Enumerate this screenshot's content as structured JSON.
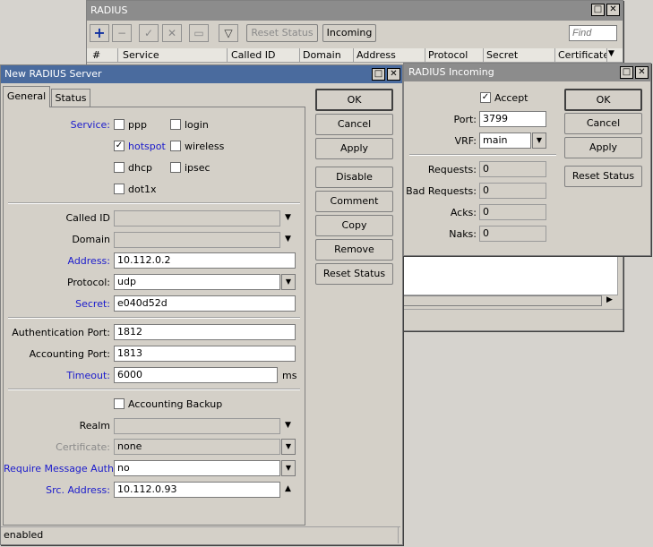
{
  "radius_window": {
    "title": "RADIUS",
    "toolbar": {
      "reset_status": "Reset Status",
      "incoming": "Incoming",
      "find_placeholder": "Find"
    },
    "columns": [
      "#",
      "Service",
      "Called ID",
      "Domain",
      "Address",
      "Protocol",
      "Secret",
      "Certificate"
    ]
  },
  "new_server": {
    "title": "New RADIUS Server",
    "tabs": [
      "General",
      "Status"
    ],
    "service_label": "Service:",
    "services": [
      {
        "name": "ppp",
        "checked": false
      },
      {
        "name": "login",
        "checked": false
      },
      {
        "name": "hotspot",
        "checked": true
      },
      {
        "name": "wireless",
        "checked": false
      },
      {
        "name": "dhcp",
        "checked": false
      },
      {
        "name": "ipsec",
        "checked": false
      },
      {
        "name": "dot1x",
        "checked": false
      }
    ],
    "called_id_label": "Called ID",
    "domain_label": "Domain",
    "address_label": "Address:",
    "address": "10.112.0.2",
    "protocol_label": "Protocol:",
    "protocol": "udp",
    "secret_label": "Secret:",
    "secret": "e040d52d",
    "auth_port_label": "Authentication Port:",
    "auth_port": "1812",
    "acct_port_label": "Accounting Port:",
    "acct_port": "1813",
    "timeout_label": "Timeout:",
    "timeout": "6000",
    "timeout_unit": "ms",
    "accounting_backup_label": "Accounting Backup",
    "realm_label": "Realm",
    "certificate_label": "Certificate:",
    "certificate": "none",
    "require_msg_auth_label": "Require Message Auth:",
    "require_msg_auth": "no",
    "src_address_label": "Src. Address:",
    "src_address": "10.112.0.93",
    "buttons": {
      "ok": "OK",
      "cancel": "Cancel",
      "apply": "Apply",
      "disable": "Disable",
      "comment": "Comment",
      "copy": "Copy",
      "remove": "Remove",
      "reset_status": "Reset Status"
    },
    "status": "enabled"
  },
  "incoming": {
    "title": "RADIUS Incoming",
    "accept_label": "Accept",
    "port_label": "Port:",
    "port": "3799",
    "vrf_label": "VRF:",
    "vrf": "main",
    "requests_label": "Requests:",
    "requests": "0",
    "bad_requests_label": "Bad Requests:",
    "bad_requests": "0",
    "acks_label": "Acks:",
    "acks": "0",
    "naks_label": "Naks:",
    "naks": "0",
    "buttons": {
      "ok": "OK",
      "cancel": "Cancel",
      "apply": "Apply",
      "reset_status": "Reset Status"
    }
  }
}
